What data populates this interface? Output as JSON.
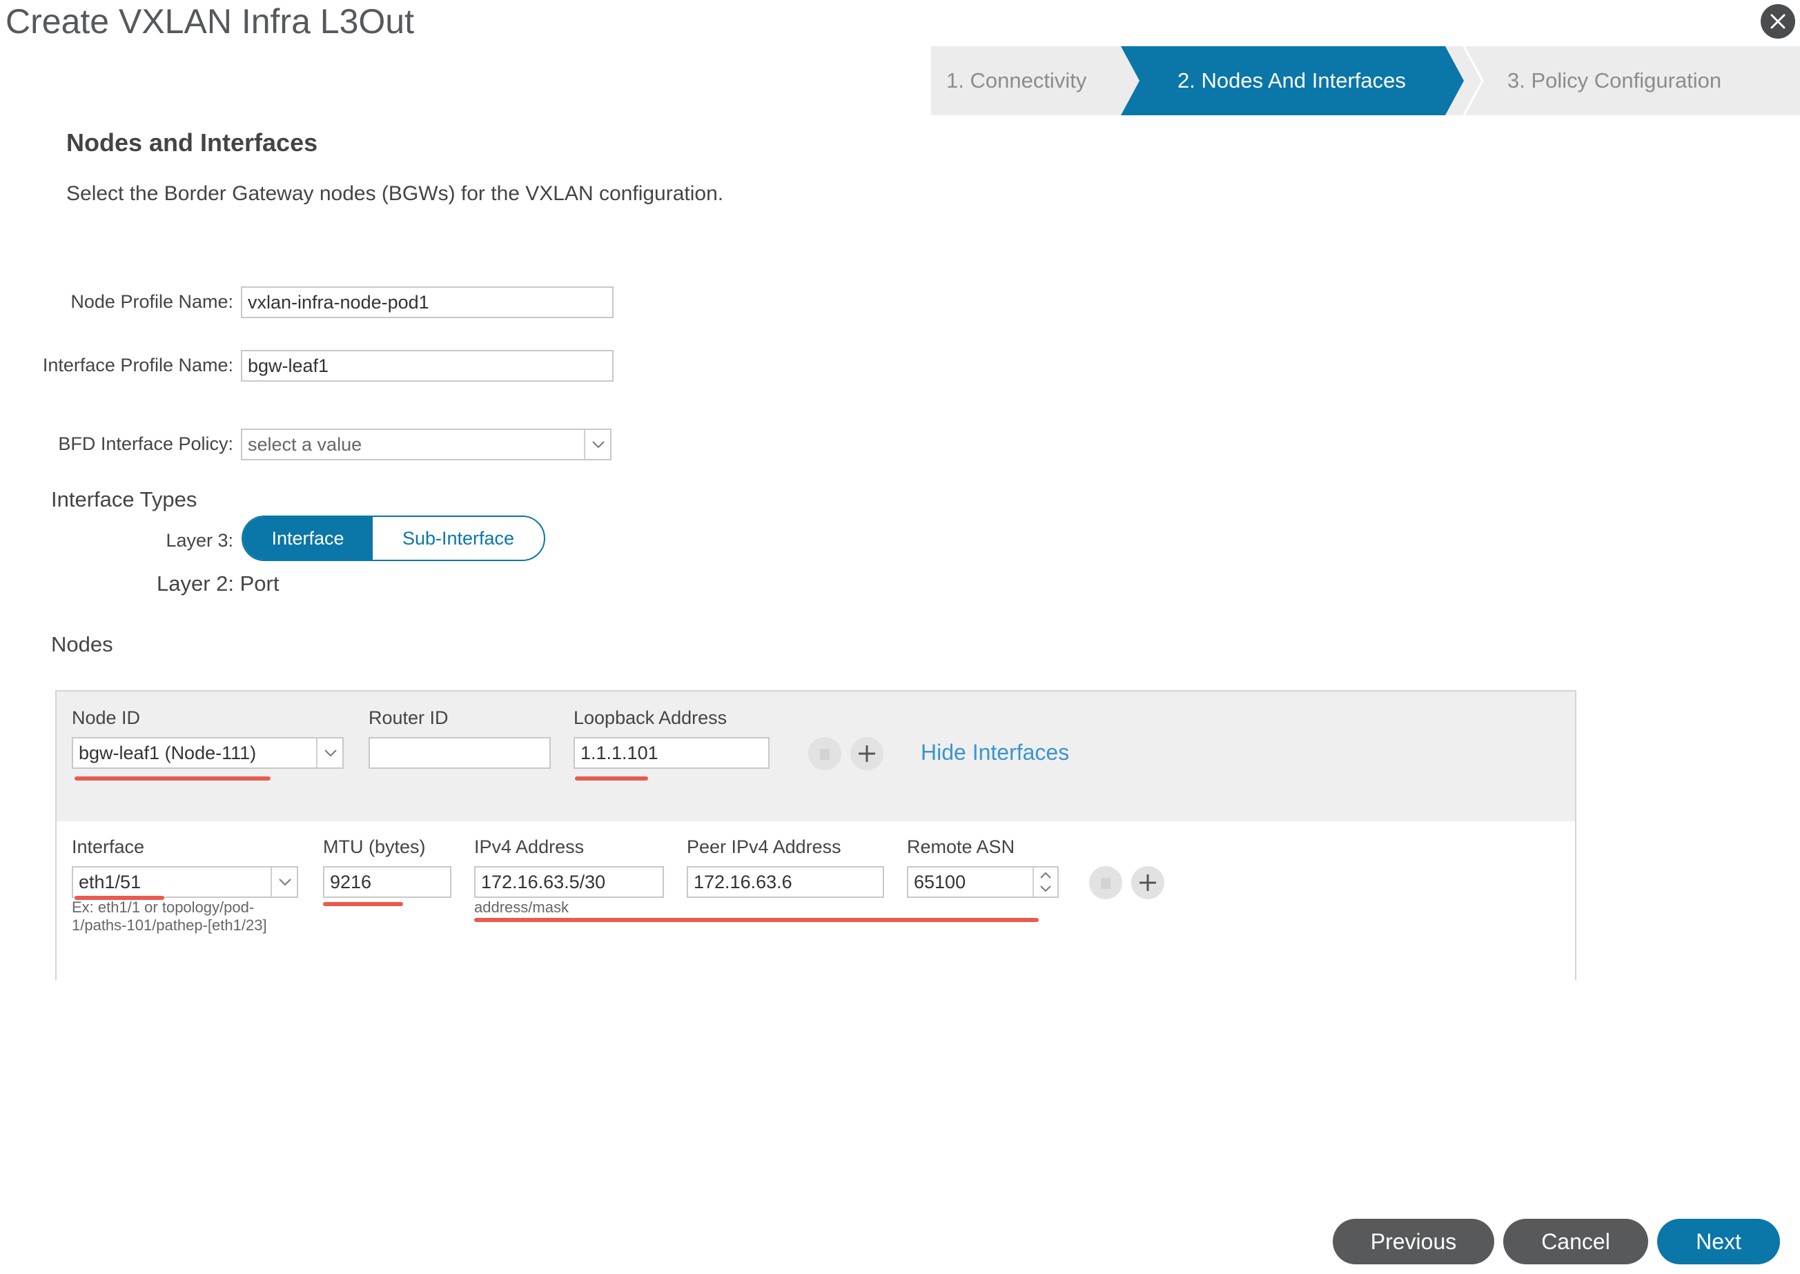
{
  "dialog": {
    "title": "Create VXLAN Infra L3Out"
  },
  "wizard": {
    "steps": [
      {
        "label": "1. Connectivity",
        "state": "done"
      },
      {
        "label": "2. Nodes And Interfaces",
        "state": "active"
      },
      {
        "label": "3. Policy Configuration",
        "state": "pending"
      }
    ]
  },
  "section": {
    "heading": "Nodes and Interfaces",
    "description": "Select the Border Gateway nodes (BGWs) for the VXLAN configuration."
  },
  "form": {
    "node_profile": {
      "label": "Node Profile Name:",
      "value": "vxlan-infra-node-pod1"
    },
    "interface_profile": {
      "label": "Interface Profile Name:",
      "value": "bgw-leaf1"
    },
    "bfd_policy": {
      "label": "BFD Interface Policy:",
      "placeholder": "select a value"
    }
  },
  "interface_types": {
    "heading": "Interface Types",
    "layer3_label": "Layer 3:",
    "options": [
      "Interface",
      "Sub-Interface"
    ],
    "selected": "Interface",
    "layer2_text": "Layer 2: Port"
  },
  "nodes": {
    "heading": "Nodes",
    "columns": {
      "node_id": "Node ID",
      "router_id": "Router ID",
      "loopback": "Loopback Address"
    },
    "row": {
      "node_id": "bgw-leaf1 (Node-111)",
      "router_id": "",
      "loopback": "1.1.1.101"
    },
    "hide_interfaces_link": "Hide Interfaces"
  },
  "interfaces": {
    "columns": {
      "interface": "Interface",
      "mtu": "MTU (bytes)",
      "ipv4": "IPv4 Address",
      "peer_ipv4": "Peer IPv4 Address",
      "remote_asn": "Remote ASN"
    },
    "row": {
      "interface": "eth1/51",
      "mtu": "9216",
      "ipv4": "172.16.63.5/30",
      "peer_ipv4": "172.16.63.6",
      "remote_asn": "65100"
    },
    "interface_hint_1": "Ex: eth1/1 or topology/pod-",
    "interface_hint_2": "1/paths-101/pathep-[eth1/23]",
    "ipv4_hint": "address/mask"
  },
  "footer": {
    "previous": "Previous",
    "cancel": "Cancel",
    "next": "Next"
  },
  "colors": {
    "accent": "#0b76a8",
    "link": "#3a95cc",
    "highlight_red": "#ea5a4f",
    "footer_gray": "#58595b"
  }
}
